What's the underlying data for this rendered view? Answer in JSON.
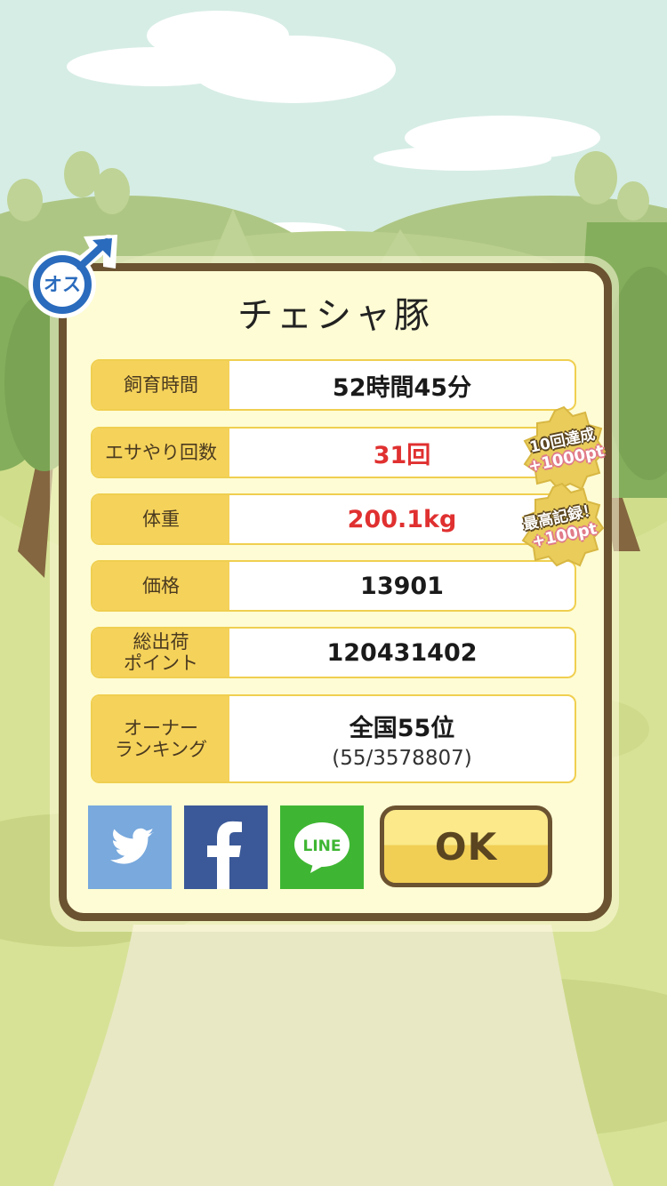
{
  "pig": {
    "name": "チェシャ豚",
    "gender_label": "オス"
  },
  "stats": [
    {
      "label": "飼育時間",
      "value": "52時間45分",
      "highlight": false
    },
    {
      "label": "エサやり回数",
      "value": "31回",
      "highlight": true
    },
    {
      "label": "体重",
      "value": "200.1kg",
      "highlight": true
    },
    {
      "label": "価格",
      "value": "13901",
      "highlight": false
    },
    {
      "label": "総出荷\nポイント",
      "value": "120431402",
      "highlight": false
    },
    {
      "label": "オーナー\nランキング",
      "value": "全国55位",
      "sub": "(55/3578807)",
      "highlight": false
    }
  ],
  "badges": [
    {
      "line1": "10回達成",
      "line2": "+1000pt"
    },
    {
      "line1": "最高記録！",
      "line2": "+100pt"
    }
  ],
  "share": {
    "twitter_icon": "twitter-bird-icon",
    "facebook_icon": "facebook-f-icon",
    "line_label": "LINE"
  },
  "ok_label": "OK",
  "colors": {
    "panel_border": "#6b5230",
    "label_bg": "#f5d25a",
    "highlight_value": "#e03030",
    "twitter": "#79a9dd",
    "facebook": "#3b5998",
    "line": "#3fb633",
    "gender_icon": "#2a6bbd"
  }
}
